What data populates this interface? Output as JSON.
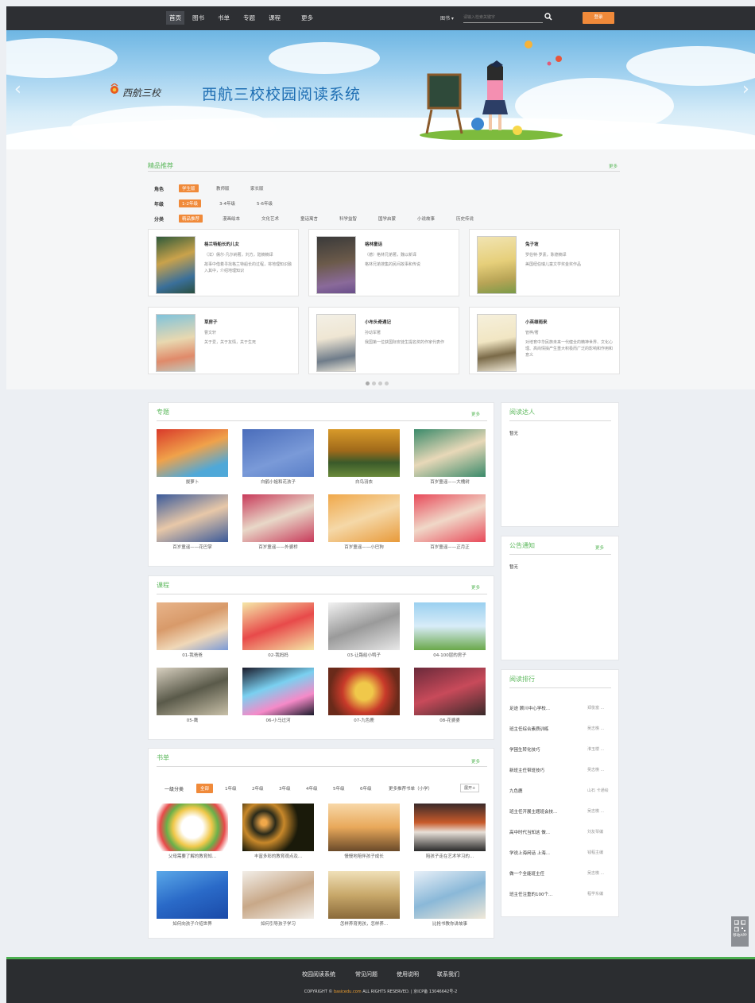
{
  "nav": {
    "items": [
      "首页",
      "图书",
      "书单",
      "专题",
      "课程",
      "更多"
    ],
    "search_select": "图书 ▾",
    "search_placeholder": "请输入检索关键字",
    "login": "登录"
  },
  "banner": {
    "school": "西航三校",
    "title": "西航三校校园阅读系统"
  },
  "featured": {
    "title": "精品推荐",
    "more": "更多",
    "role_label": "角色",
    "roles": [
      "学生版",
      "教师版",
      "家长版"
    ],
    "grade_label": "年级",
    "grades": [
      "1-2年级",
      "3-4年级",
      "5-6年级"
    ],
    "cat_label": "分类",
    "categories": [
      "精品推荐",
      "漫画绘本",
      "文化艺术",
      "童话寓言",
      "科学益智",
      "国学启蒙",
      "小说故事",
      "历史传说"
    ],
    "books": [
      {
        "title": "格兰特船长的儿女",
        "author": "（法）儒尔·凡尔纳著，刘方，陆楠楠译",
        "desc": "故事中借着寻找格兰特船长的过程，将地理知识融入其中，介绍地理知识"
      },
      {
        "title": "格林童话",
        "author": "（德）格林兄弟著，魏以新译",
        "desc": "格林兄弟搜集的民间故事和传说"
      },
      {
        "title": "兔子坡",
        "author": "罗伯特·罗素，陈德楠译",
        "desc": "美国纽伯瑞儿童文学奖金奖作品"
      },
      {
        "title": "草房子",
        "author": "曹文轩",
        "desc": "关于爱，关于友情，关于生死"
      },
      {
        "title": "小布头奇遇记",
        "author": "孙幼军著",
        "desc": "我国第一位获国际安徒生提名奖的作家代表作"
      },
      {
        "title": "小英雄雨来",
        "author": "管桦/著",
        "desc": "对培育中华民族未来一代健全的精神世界、文化心理、高尚情操产生重大积极而广泛的影响和作用和意义"
      }
    ]
  },
  "topics": {
    "title": "专题",
    "more": "更多",
    "items": [
      "拔萝卜",
      "白鹤小姐和花孩子",
      "白鸟羽衣",
      "百岁童谣——大槐树",
      "百岁童谣——花巴掌",
      "百岁童谣——外婆桥",
      "百岁童谣——小巴狗",
      "百岁童谣——正月正"
    ]
  },
  "courses": {
    "title": "课程",
    "more": "更多",
    "items": [
      "01-我爸爸",
      "02-我妈妈",
      "03-让路给小鸭子",
      "04-100层的房子",
      "05-鹰",
      "06-小马过河",
      "07-九色鹿",
      "08-花婆婆"
    ]
  },
  "booklists": {
    "title": "书单",
    "more": "更多",
    "filter_label": "一级分类",
    "filters": [
      "全部",
      "1年级",
      "2年级",
      "3年级",
      "4年级",
      "5年级",
      "6年级",
      "更多推荐书单（小学）"
    ],
    "expand": "展开+",
    "items": [
      "父母需要了解的教育知...",
      "丰富多彩的教育观点及...",
      "慢慢地陪伴孩子成长",
      "陪孩子走在艺术学习的...",
      "如何向孩子介绍世界",
      "如何引导孩子学习",
      "怎样养育男孩，怎样养...",
      "比抢书教你讲故事"
    ]
  },
  "readers": {
    "title": "阅读达人",
    "empty": "暂无"
  },
  "notice": {
    "title": "公告通知",
    "more": "更多",
    "empty": "暂无"
  },
  "ranking": {
    "title": "阅读排行",
    "items": [
      {
        "title": "足迹 顾川中心学校...",
        "author": "郑俊富 ..."
      },
      {
        "title": "班主任综合素质训练",
        "author": "吴志樵 ..."
      },
      {
        "title": "学困生转化技巧",
        "author": "淮玉楼 ..."
      },
      {
        "title": "新班主任带班技巧",
        "author": "吴志樵 ..."
      },
      {
        "title": "九色鹿",
        "author": "山石 卡通绘"
      },
      {
        "title": "班主任开展主题班会技...",
        "author": "吴志樵 ..."
      },
      {
        "title": "高中时代当知这 做...",
        "author": "刘友琴编"
      },
      {
        "title": "学说上海闲话 上海...",
        "author": "钱程主编"
      },
      {
        "title": "做一个全能班主任",
        "author": "吴志樵 ..."
      },
      {
        "title": "班主任注重的100个...",
        "author": "程学东编"
      }
    ]
  },
  "footer": {
    "links": [
      "校园阅读系统",
      "常见问题",
      "使用说明",
      "联系我们"
    ],
    "copyright_pre": "COPYRIGHT ©",
    "domain": "basicedu.com",
    "copyright_post": "ALL RIGHTS RESERVED. | 京ICP备 13046642号-2"
  },
  "qr": {
    "label": "移动APP"
  }
}
